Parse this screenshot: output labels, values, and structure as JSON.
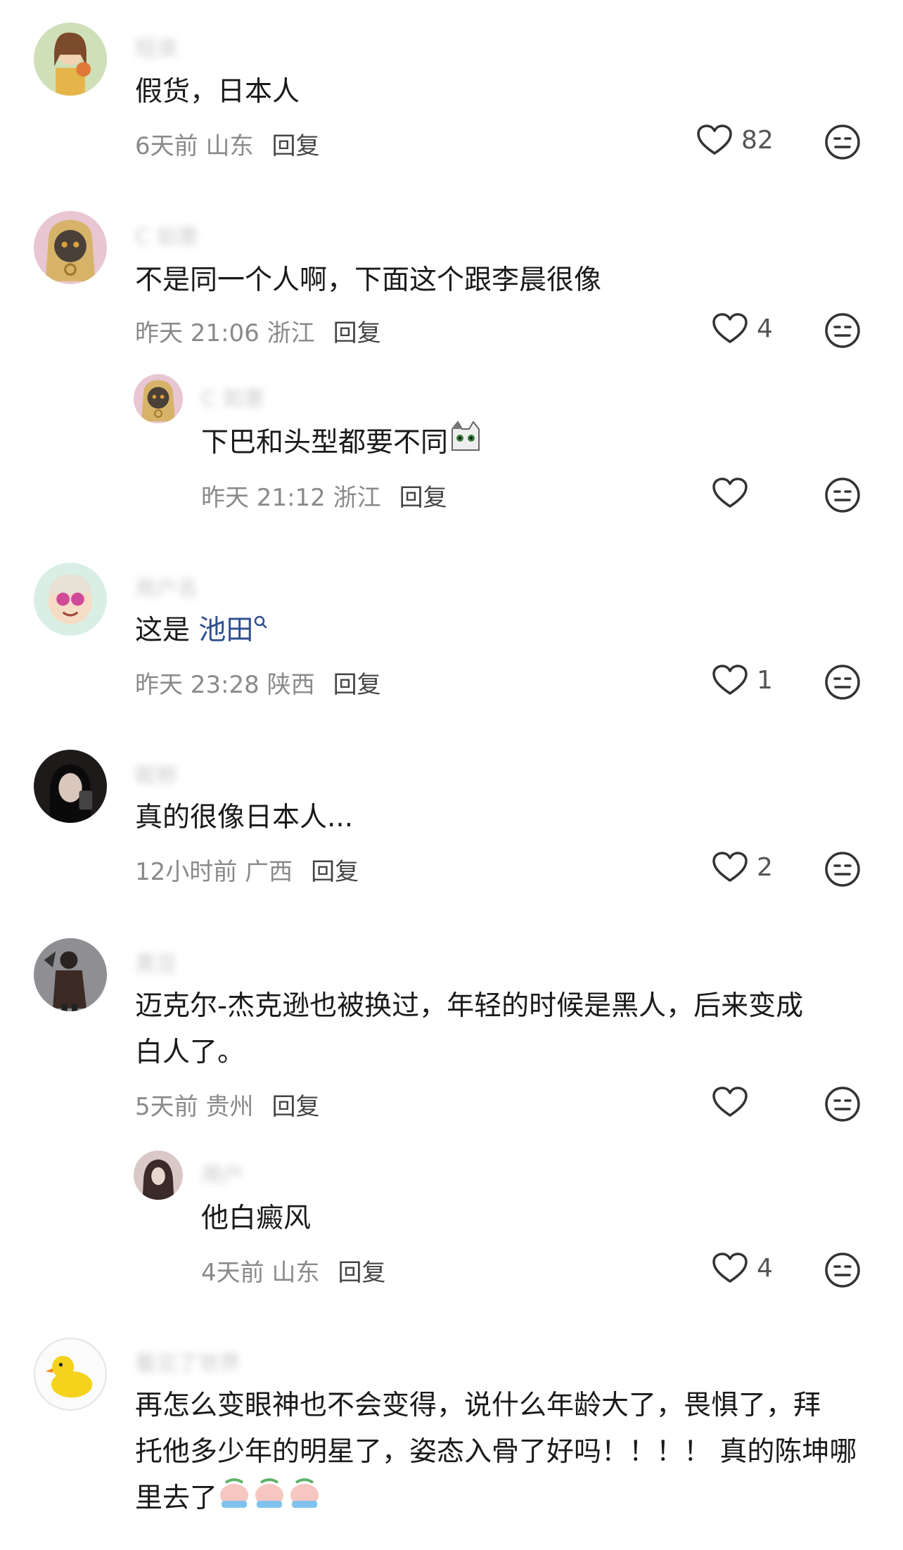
{
  "comments": [
    {
      "name": "短浪",
      "text": "假货，日本人",
      "time": "6天前 山东",
      "reply": "回复",
      "likes": "82"
    },
    {
      "name": "C 如意",
      "text": "不是同一个人啊，下面这个跟李晨很像",
      "time": "昨天 21:06 浙江",
      "reply": "回复",
      "likes": "4"
    },
    {
      "name": "C 如意",
      "text": "下巴和头型都要不同",
      "time": "昨天 21:12 浙江",
      "reply": "回复",
      "likes": ""
    },
    {
      "name": "用户名",
      "text_prefix": "这是 ",
      "text_link": "池田",
      "time": "昨天 23:28 陕西",
      "reply": "回复",
      "likes": "1"
    },
    {
      "name": "昵称",
      "text": "真的很像日本人...",
      "time": "12小时前 广西",
      "reply": "回复",
      "likes": "2"
    },
    {
      "name": "黑豆",
      "text_line1": "迈克尔-杰克逊也被换过，年轻的时候是黑人，后来变成",
      "text_line2": "白人了。",
      "time": "5天前 贵州",
      "reply": "回复",
      "likes": ""
    },
    {
      "name": "用户",
      "text": "他白癜风",
      "time": "4天前 山东",
      "reply": "回复",
      "likes": "4"
    },
    {
      "name": "看见了世界",
      "text_line1": "再怎么变眼神也不会变得，说什么年龄大了，畏惧了，拜",
      "text_line2": "托他多少年的明星了，姿态入骨了好吗！！！！ 真的陈坤哪",
      "text_line3": "里去了"
    }
  ],
  "icons": {
    "like": "heart-outline-icon",
    "reaction": "neutral-face-icon",
    "search_tag": "search-icon"
  },
  "colors": {
    "accent_link": "#2f4f8f",
    "meta": "#8a8a8a"
  }
}
